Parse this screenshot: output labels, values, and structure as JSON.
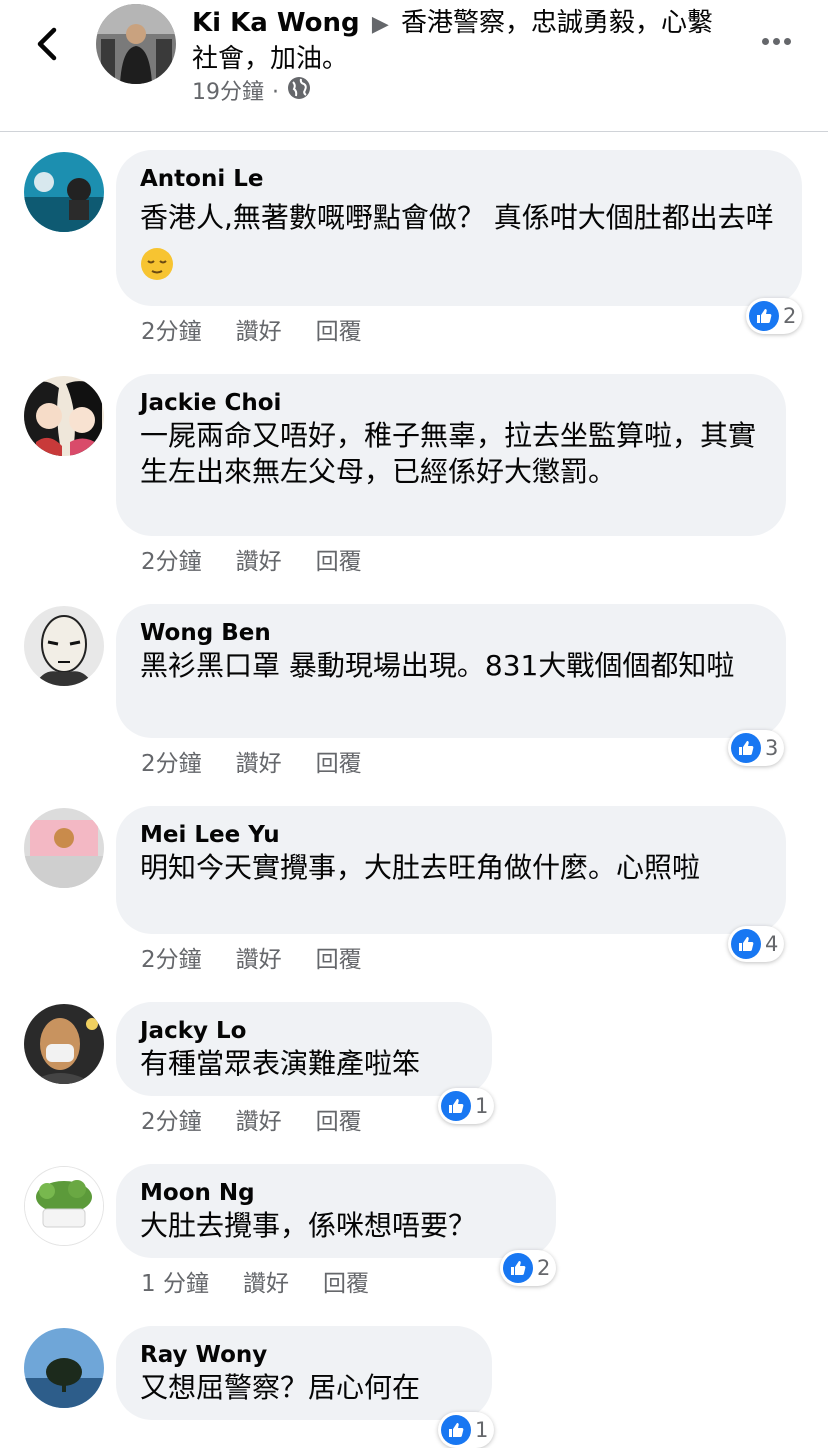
{
  "header": {
    "author": "Ki Ka Wong",
    "arrow": "▶",
    "title_text": "香港警察，忠誠勇毅，心繫社會，加油。",
    "time": "19分鐘",
    "separator": "·",
    "privacy_icon": "globe-icon",
    "more_icon": "more-dots-icon",
    "back_icon": "chevron-left-icon"
  },
  "actions": {
    "like": "讚好",
    "reply": "回覆"
  },
  "comments": [
    {
      "name": "Antoni Le",
      "text": "香港人,無著數嘅嘢點會做？ 真係咁大個肚都出去咩",
      "emoji": "relieved-face-emoji",
      "time": "2分鐘",
      "reactions": "2"
    },
    {
      "name": "Jackie Choi",
      "text": "一屍兩命又唔好，稚子無辜，拉去坐監算啦，其實生左出來無左父母，已經係好大懲罰。",
      "time": "2分鐘",
      "reactions": ""
    },
    {
      "name": "Wong Ben",
      "text": "黑衫黑口罩 暴動現場出現。831大戰個個都知啦",
      "time": "2分鐘",
      "reactions": "3"
    },
    {
      "name": "Mei Lee Yu",
      "text": "明知今天實攪事，大肚去旺角做什麼。心照啦",
      "time": "2分鐘",
      "reactions": "4"
    },
    {
      "name": "Jacky Lo",
      "text": "有種當眾表演難產啦笨",
      "time": "2分鐘",
      "reactions": "1"
    },
    {
      "name": "Moon Ng",
      "text": "大肚去攪事，係咪想唔要？",
      "time": "1 分鐘",
      "reactions": "2"
    },
    {
      "name": "Ray Wony",
      "text": "又想屈警察？居心何在",
      "time": "",
      "reactions": "1"
    }
  ],
  "colors": {
    "like_blue": "#1877f2",
    "bubble_bg": "#f0f2f5",
    "meta_gray": "#65676b"
  }
}
